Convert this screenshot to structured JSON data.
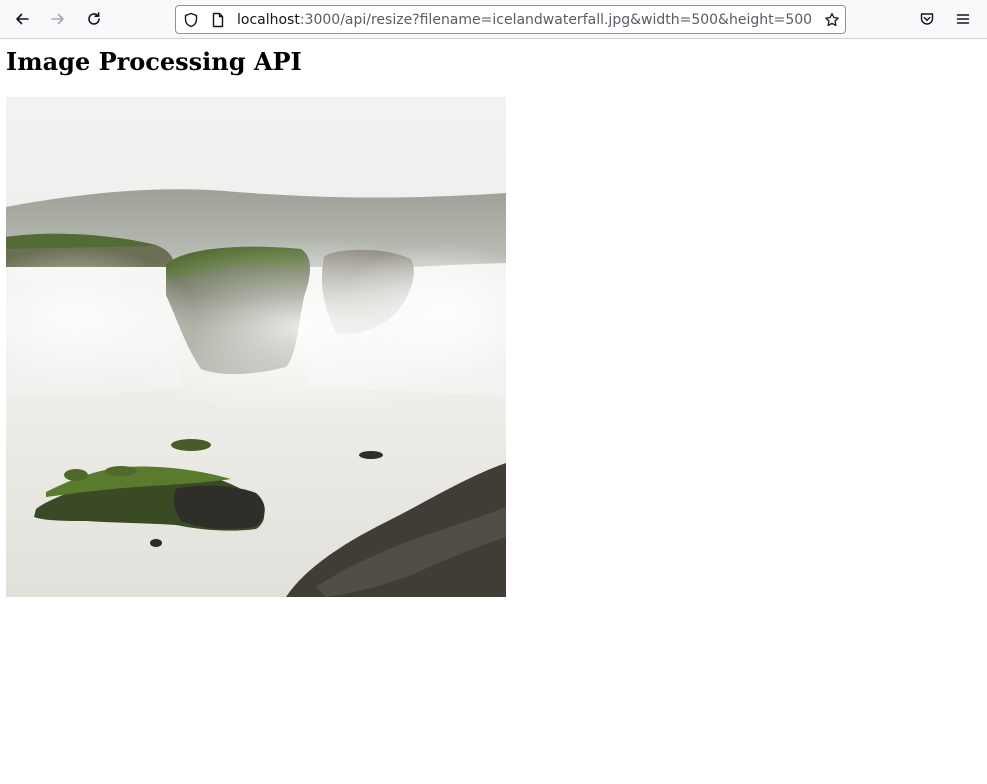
{
  "browser": {
    "url_host": "localhost",
    "url_rest": ":3000/api/resize?filename=icelandwaterfall.jpg&width=500&height=500",
    "icons": {
      "back": "arrow-left-icon",
      "forward": "arrow-right-icon",
      "reload": "reload-icon",
      "tracking_protection": "shield-icon",
      "page_info": "page-icon",
      "bookmark": "star-icon",
      "pocket": "pocket-icon",
      "menu": "hamburger-menu-icon"
    }
  },
  "page": {
    "heading": "Image Processing API",
    "image": {
      "description_kind": "waterfall-photo",
      "colors": {
        "sky": "#ededeb",
        "mist": "#f4f4f2",
        "water": "#e8e7e3",
        "moss": "#4f6a2a",
        "rock": "#3a3a34"
      }
    }
  }
}
